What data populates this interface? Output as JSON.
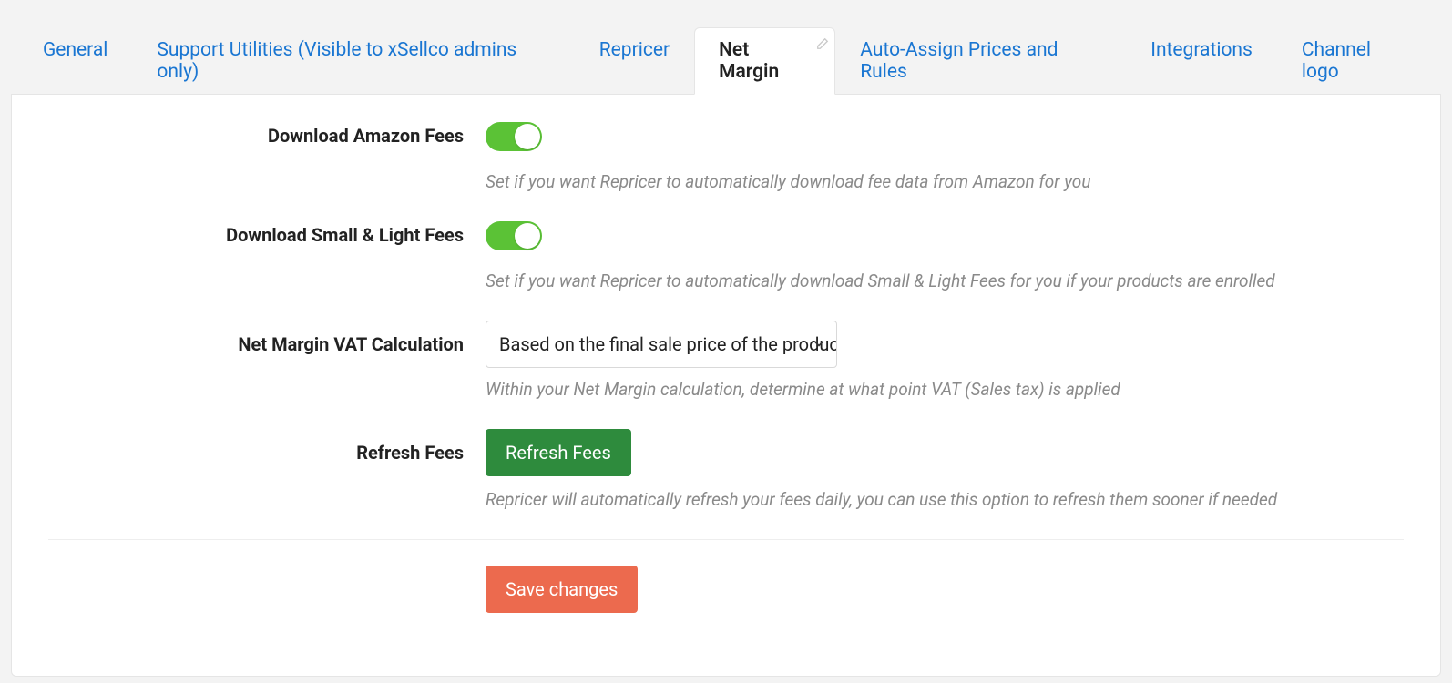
{
  "tabs": [
    {
      "label": "General",
      "active": false
    },
    {
      "label": "Support Utilities (Visible to xSellco admins only)",
      "active": false
    },
    {
      "label": "Repricer",
      "active": false
    },
    {
      "label": "Net Margin",
      "active": true
    },
    {
      "label": "Auto-Assign Prices and Rules",
      "active": false
    },
    {
      "label": "Integrations",
      "active": false
    },
    {
      "label": "Channel logo",
      "active": false
    }
  ],
  "fields": {
    "download_amazon_fees": {
      "label": "Download Amazon Fees",
      "helper": "Set if you want Repricer to automatically download fee data from Amazon for you",
      "value": true
    },
    "download_small_light_fees": {
      "label": "Download Small & Light Fees",
      "helper": "Set if you want Repricer to automatically download Small & Light Fees for you if your products are enrolled",
      "value": true
    },
    "vat_calc": {
      "label": "Net Margin VAT Calculation",
      "helper": "Within your Net Margin calculation, determine at what point VAT (Sales tax) is applied",
      "selected": "Based on the final sale price of the product"
    },
    "refresh_fees": {
      "label": "Refresh Fees",
      "button": "Refresh Fees",
      "helper": "Repricer will automatically refresh your fees daily, you can use this option to refresh them sooner if needed"
    }
  },
  "actions": {
    "save": "Save changes"
  }
}
